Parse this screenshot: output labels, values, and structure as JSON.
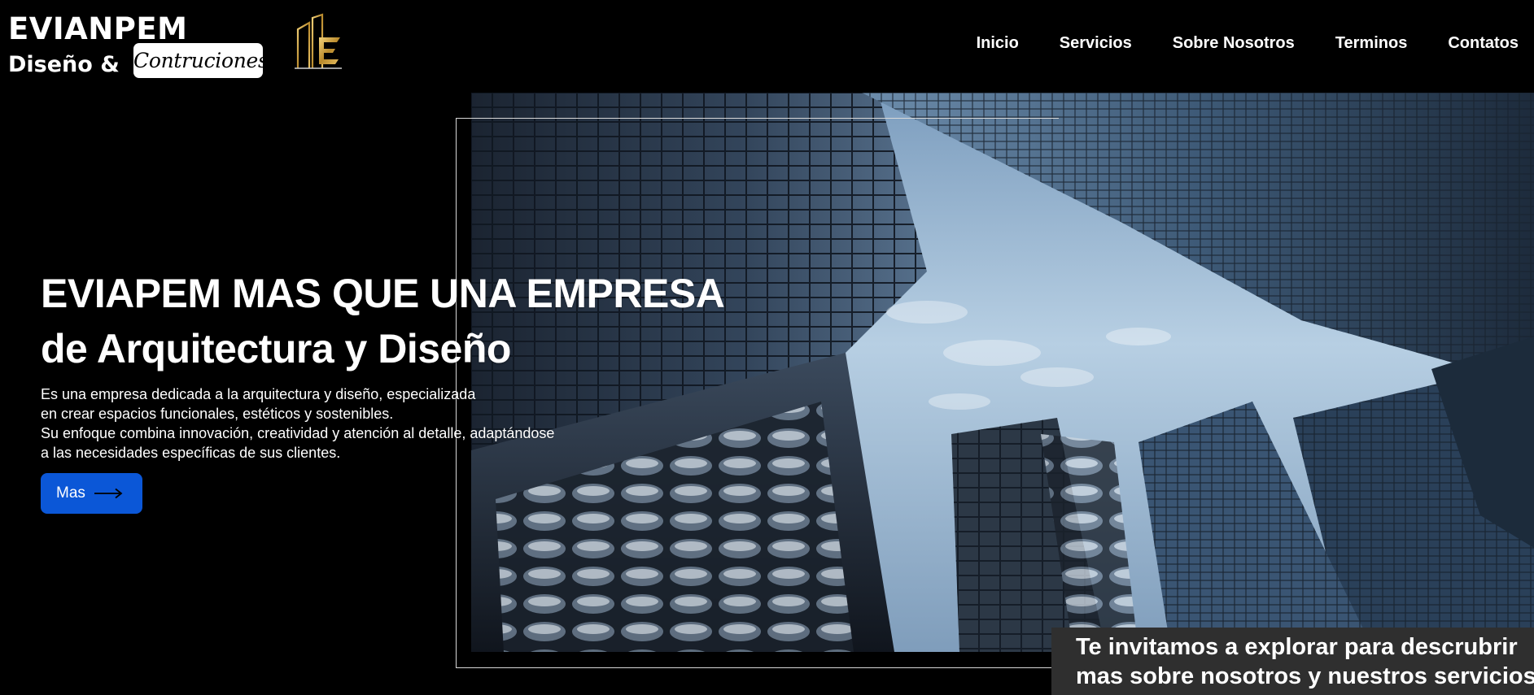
{
  "brand": {
    "name": "EVIANPEM",
    "subtitle": "Diseño &",
    "pill": "Contruciones",
    "logo_icon": "building-logo-icon"
  },
  "nav": {
    "items": [
      {
        "label": "Inicio"
      },
      {
        "label": "Servicios"
      },
      {
        "label": "Sobre Nosotros"
      },
      {
        "label": "Terminos"
      },
      {
        "label": "Contatos"
      }
    ]
  },
  "hero": {
    "title_line1": "EVIAPEM MAS QUE UNA EMPRESA",
    "title_line2": "de Arquitectura y Diseño",
    "description_lines": [
      "Es una empresa dedicada a la arquitectura y diseño, especializada",
      "en crear espacios funcionales, estéticos y sostenibles.",
      "Su enfoque combina innovación, creatividad y atención al detalle, adaptándose",
      "a las necesidades específicas de sus clientes."
    ],
    "button_label": "Mas",
    "button_icon": "arrow-right-icon",
    "image_subject": "skyscrapers-looking-up-photo"
  },
  "cta": {
    "line1": "Te invitamos a explorar para descrubrir",
    "line2": "mas sobre nosotros y nuestros servicios"
  },
  "colors": {
    "background": "#000000",
    "accent_button": "#0b57d7",
    "cta_background": "#2f2f2f",
    "text": "#ffffff"
  }
}
